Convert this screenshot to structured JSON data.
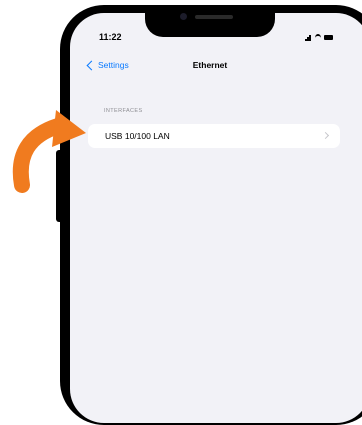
{
  "status_bar": {
    "time": "11:22"
  },
  "nav": {
    "back_label": "Settings",
    "title": "Ethernet"
  },
  "section": {
    "header": "INTERFACES"
  },
  "rows": [
    {
      "label": "USB 10/100 LAN"
    }
  ],
  "colors": {
    "accent": "#0a7aff",
    "annotation_arrow": "#f07b1f",
    "background": "#f2f2f7"
  },
  "annotation": {
    "icon": "curved-arrow-icon"
  }
}
